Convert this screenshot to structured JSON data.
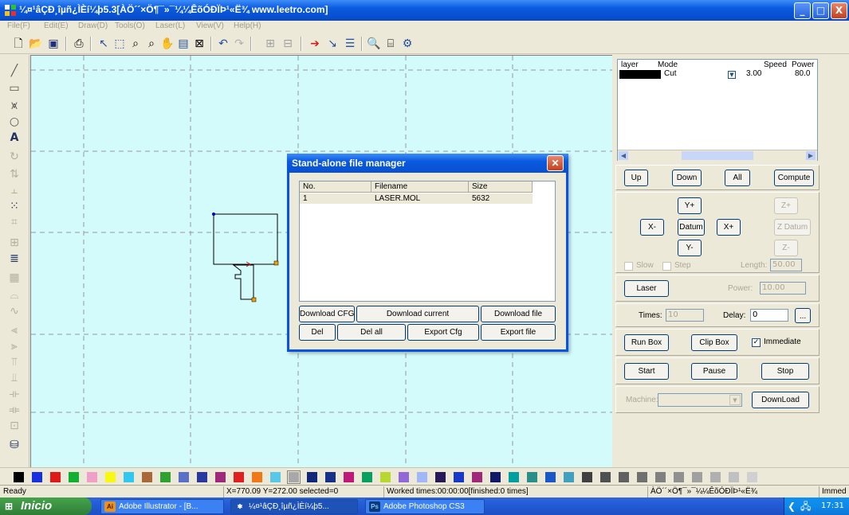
{
  "window": {
    "title": "¼¤¹âÇÐ¸îµñ¿ÌÈí¼þ5.3[ÀÖ´´×Ö¶¯»¯¼¼ÊõÓÐÏÞ¹«Ë¾ www.leetro.com]",
    "minimize": "_",
    "maximize": "□",
    "close": "X"
  },
  "menu": [
    "File(F)",
    "Edit(E)",
    "Draw(D)",
    "Tools(O)",
    "Laser(L)",
    "View(V)",
    "Help(H)"
  ],
  "toolbar_icons": [
    "new-icon",
    "open-icon",
    "save-icon",
    "print-icon",
    "select-icon",
    "node-edit-icon",
    "zoom-in-icon",
    "zoom-out-icon",
    "pan-icon",
    "zoom-page-icon",
    "zoom-fit-icon",
    "undo-icon",
    "redo-icon",
    "group-icon",
    "ungroup-icon",
    "cut-path-icon",
    "lead-line-icon",
    "array-icon",
    "preview-icon",
    "simulate-icon",
    "settings-icon"
  ],
  "layers": {
    "headers": {
      "layer": "layer",
      "mode": "Mode",
      "speed": "Speed",
      "power": "Power"
    },
    "rows": [
      {
        "color": "#000000",
        "mode": "Cut",
        "speed": "3.00",
        "power": "80.0"
      }
    ]
  },
  "controls": {
    "up": "Up",
    "down": "Down",
    "all": "All",
    "compute": "Compute",
    "y_plus": "Y+",
    "y_minus": "Y-",
    "x_minus": "X-",
    "x_plus": "X+",
    "datum": "Datum",
    "z_plus": "Z+",
    "z_minus": "Z-",
    "z_datum": "Z Datum",
    "slow": "Slow",
    "step": "Step",
    "length_label": "Length:",
    "length_value": "50.00",
    "laser": "Laser",
    "power_label": "Power:",
    "power_value": "10.00",
    "times_label": "Times:",
    "times_value": "10",
    "delay_label": "Delay:",
    "delay_value": "0",
    "ellipsis": "...",
    "run_box": "Run Box",
    "clip_box": "Clip Box",
    "immediate": "Immediate",
    "start": "Start",
    "pause": "Pause",
    "stop": "Stop",
    "machine_label": "Machine:",
    "machine_value": "",
    "download": "DownLoad"
  },
  "dialog": {
    "title": "Stand-alone file manager",
    "columns": [
      "No.",
      "Filename",
      "Size"
    ],
    "files": [
      {
        "no": "1",
        "filename": "LASER.MOL",
        "size": "5632"
      }
    ],
    "download_cfg": "Download CFG",
    "download_current": "Download current",
    "download_file": "Download file",
    "del": "Del",
    "del_all": "Del all",
    "export_cfg": "Export Cfg",
    "export_file": "Export file"
  },
  "palette": [
    "#000000",
    "#1830e0",
    "#e01818",
    "#10b030",
    "#f0a0c8",
    "#f8f810",
    "#30c8f0",
    "#a86838",
    "#30a030",
    "#5870c8",
    "#2838a0",
    "#a02878",
    "#e02020",
    "#f07818",
    "#58c8e8",
    "#a8a8a8",
    "#102878",
    "#183088",
    "#c01878",
    "#08a060",
    "#b8d830",
    "#9068d8",
    "#a0b8f8",
    "#281858",
    "#1838c8",
    "#a02878",
    "#101868",
    "#00a0a0",
    "#289088",
    "#1858c8",
    "#40a0c0",
    "#404040",
    "#505050",
    "#606060",
    "#707070",
    "#808080",
    "#909090",
    "#a0a0a0",
    "#b0b0b0",
    "#c0c0c0",
    "#d0d0d0"
  ],
  "status": {
    "ready": "Ready",
    "coords": "X=770.09 Y=272.00 selected=0",
    "worked": "Worked times:00:00:00[finished:0 times]",
    "company": "ÀÖ´´×Ö¶¯»¯¼¼ÊõÓÐÏÞ¹«Ë¾",
    "mode": "Immed"
  },
  "taskbar": {
    "start": "Inicio",
    "tasks": [
      {
        "icon": "Ai",
        "label": "Adobe Illustrator - [B..."
      },
      {
        "icon": "✱",
        "label": "¼¤¹âÇÐ¸îµñ¿ÌÈí¼þ5..."
      },
      {
        "icon": "Ps",
        "label": "Adobe Photoshop CS3"
      }
    ],
    "clock": "17:31"
  }
}
